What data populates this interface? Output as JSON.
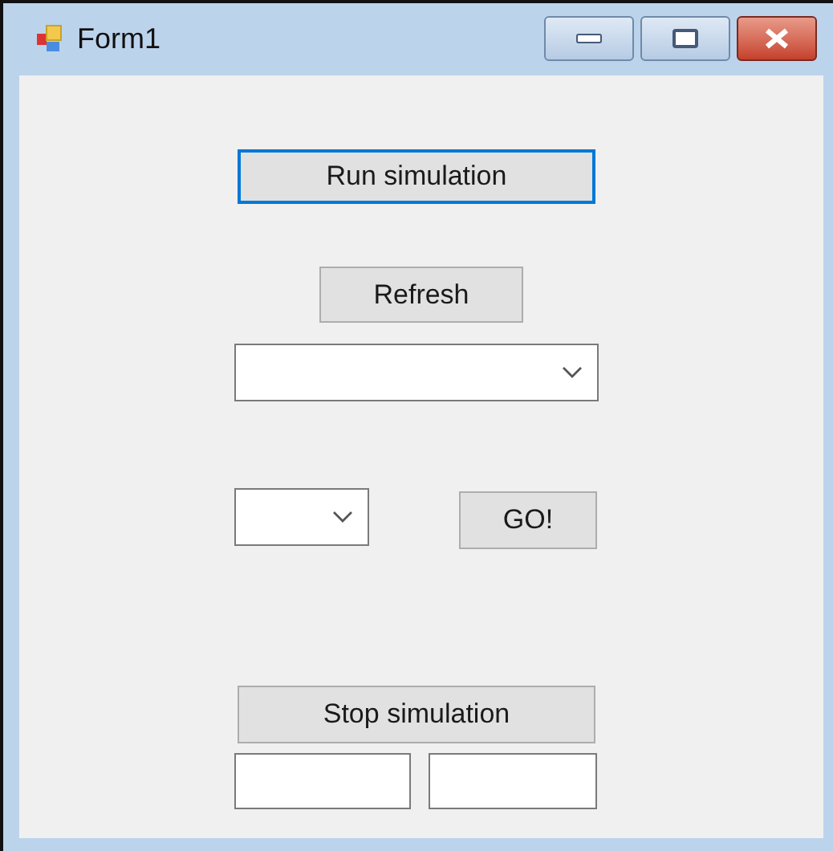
{
  "window": {
    "title": "Form1"
  },
  "run_button": {
    "label": "Run simulation",
    "focused": true
  },
  "refresh_button": {
    "label": "Refresh",
    "focused": false
  },
  "go_button": {
    "label": "GO!",
    "focused": false
  },
  "stop_button": {
    "label": "Stop simulation",
    "focused": false
  }
}
